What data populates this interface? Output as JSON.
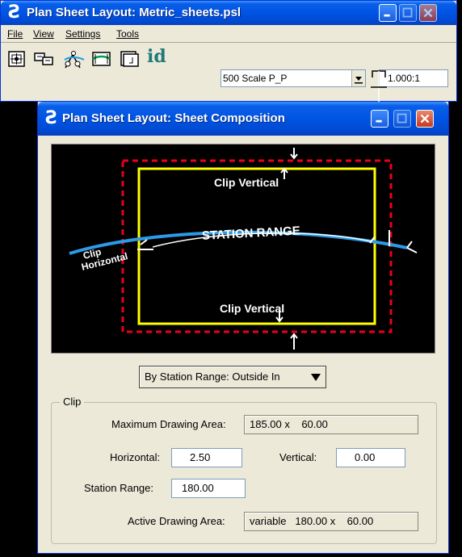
{
  "main_window": {
    "title": "Plan Sheet Layout: Metric_sheets.psl",
    "menu": [
      {
        "label": "File"
      },
      {
        "label": "View"
      },
      {
        "label": "Settings"
      },
      {
        "label": "Tools"
      }
    ],
    "toolbar": {
      "tools": [
        "place-sheet-icon",
        "sheet-layout-icon",
        "station-range-icon",
        "clip-shape-icon",
        "sheet-file-icon",
        "id-icon"
      ],
      "id_glyph": "id",
      "scale_combo_value": "500 Scale P_P",
      "scale_ratio_value": "1.000:1"
    }
  },
  "dialog": {
    "title": "Plan Sheet Layout: Sheet Composition",
    "preview": {
      "clip_vertical_top": "Clip Vertical",
      "clip_vertical_bottom": "Clip Vertical",
      "station_range": "STATION RANGE",
      "clip_horizontal_line1": "Clip",
      "clip_horizontal_line2": "Horizontal"
    },
    "mode_select": "By Station Range: Outside In",
    "clip": {
      "legend": "Clip",
      "max_area_label": "Maximum Drawing Area:",
      "max_area_value": "185.00 x    60.00",
      "horizontal_label": "Horizontal:",
      "horizontal_value": "2.50",
      "vertical_label": "Vertical:",
      "vertical_value": "0.00",
      "station_range_label": "Station Range:",
      "station_range_value": "180.00",
      "active_area_label": "Active Drawing Area:",
      "active_area_value": "variable   180.00 x    60.00"
    }
  },
  "colors": {
    "title_blue": "#0054e3",
    "close_red": "#c7391c",
    "clip_red": "#e8001c",
    "sheet_yellow": "#ffff00",
    "station_line": "#2b9be8"
  }
}
